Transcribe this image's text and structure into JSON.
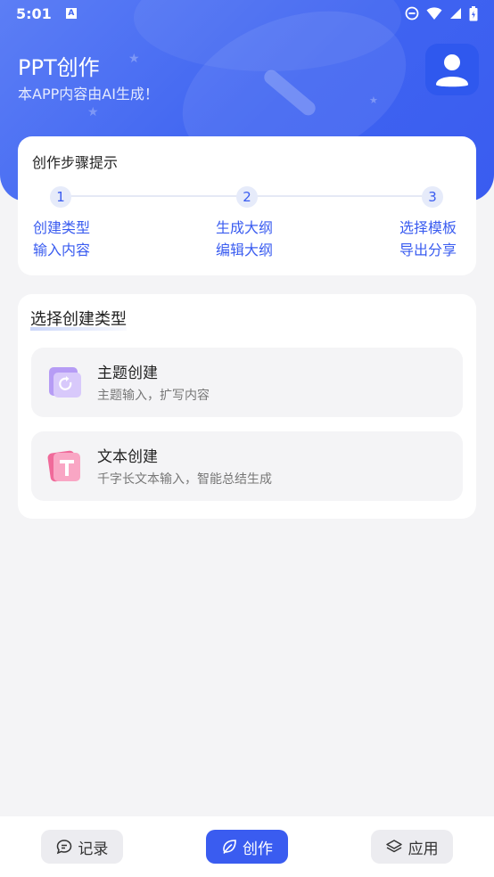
{
  "status_bar": {
    "time": "5:01",
    "notification_icon": "A"
  },
  "header": {
    "title": "PPT创作",
    "subtitle": "本APP内容由AI生成！"
  },
  "steps": {
    "title": "创作步骤提示",
    "items": [
      {
        "num": "1",
        "line1": "创建类型",
        "line2": "输入内容"
      },
      {
        "num": "2",
        "line1": "生成大纲",
        "line2": "编辑大纲"
      },
      {
        "num": "3",
        "line1": "选择模板",
        "line2": "导出分享"
      }
    ]
  },
  "types": {
    "title": "选择创建类型",
    "items": [
      {
        "title": "主题创建",
        "desc": "主题输入，扩写内容",
        "icon": "folder-refresh-icon",
        "color": "#a88df2"
      },
      {
        "title": "文本创建",
        "desc": "千字长文本输入，智能总结生成",
        "icon": "text-t-icon",
        "color": "#f06a9a"
      }
    ]
  },
  "bottom_nav": {
    "items": [
      {
        "label": "记录",
        "icon": "chat-bubble-icon",
        "active": false
      },
      {
        "label": "创作",
        "icon": "create-leaf-icon",
        "active": true
      },
      {
        "label": "应用",
        "icon": "layers-icon",
        "active": false
      }
    ]
  },
  "colors": {
    "accent": "#3a5cf0",
    "background": "#f4f4f6"
  }
}
